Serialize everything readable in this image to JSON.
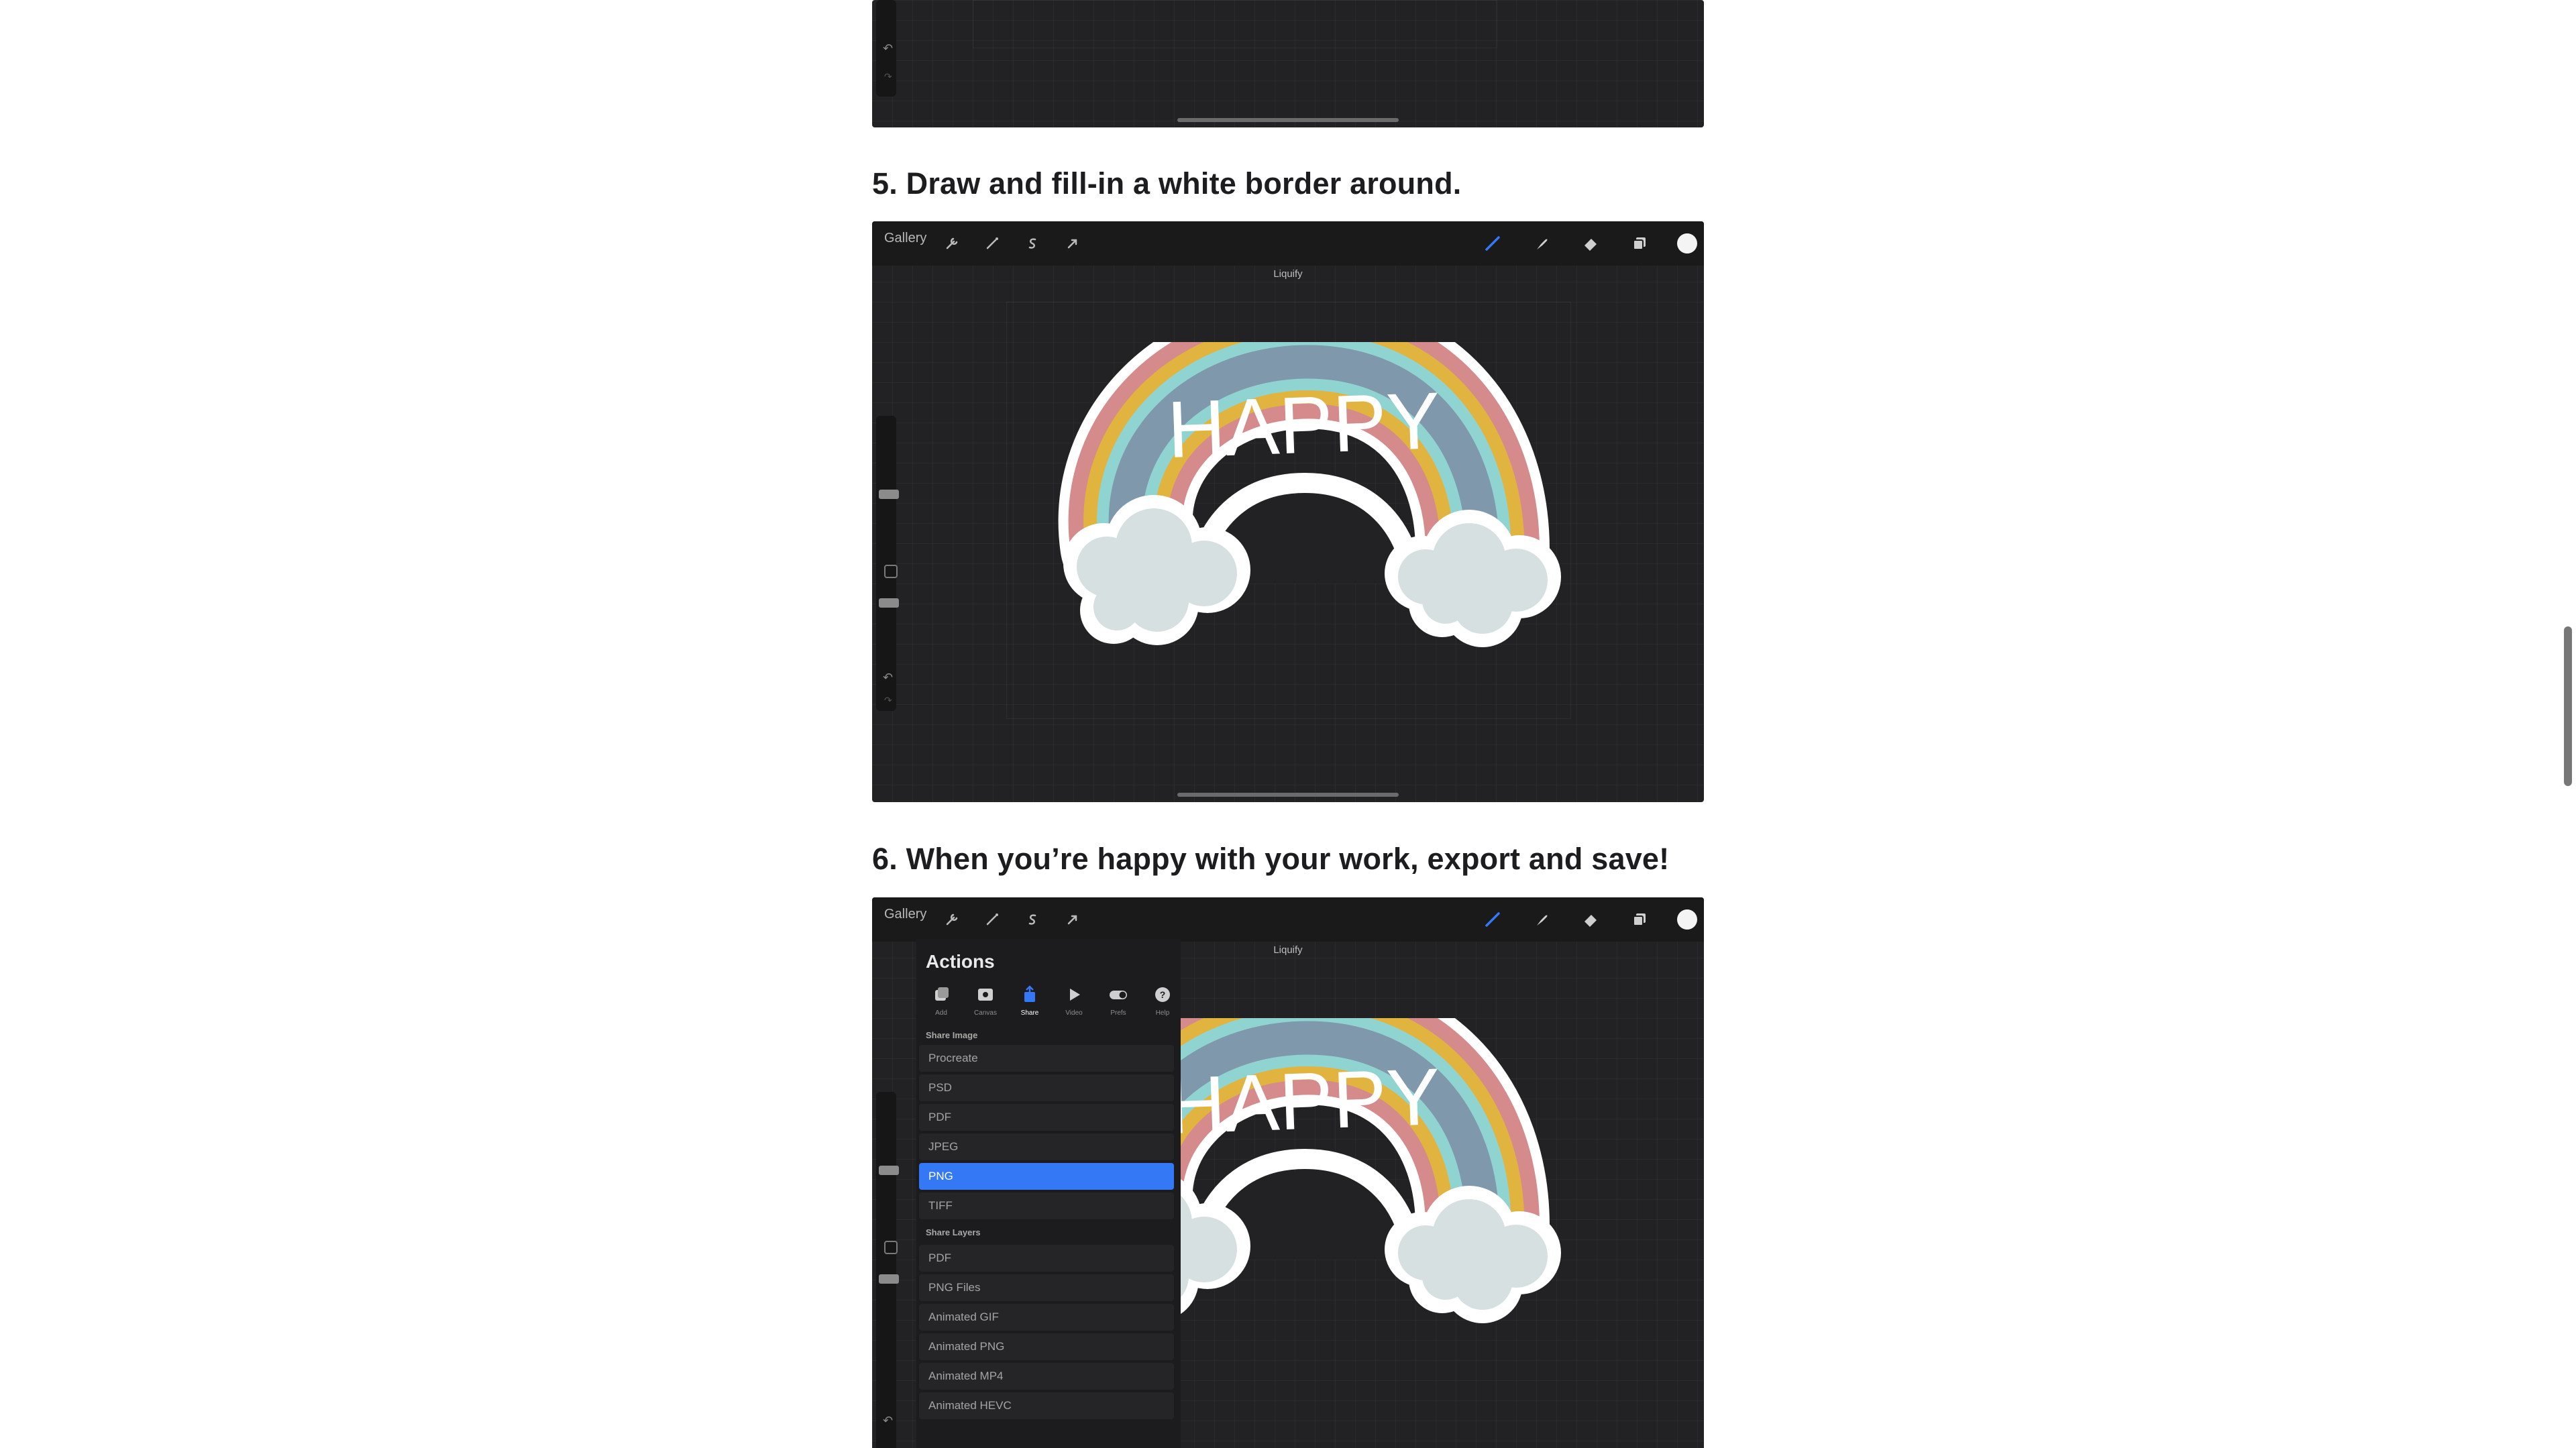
{
  "steps": [
    {
      "heading": "5. Draw and fill-in a white border around."
    },
    {
      "heading": "6. When you’re happy with your work, export and save!"
    }
  ],
  "app": {
    "gallery_label": "Gallery",
    "canvas_label": "Liquify",
    "sticker_text": "HAPPY",
    "toolbar_left_icons": [
      "wrench-icon",
      "magic-wand-icon",
      "selection-s-icon",
      "transform-arrow-icon"
    ],
    "toolbar_right_icons": [
      "brush-icon",
      "smudge-icon",
      "eraser-icon",
      "layers-icon",
      "color-swatch-icon"
    ],
    "accent_color": "#3478f6"
  },
  "actions": {
    "title": "Actions",
    "tabs": [
      {
        "label": "Add",
        "icon": "add-icon"
      },
      {
        "label": "Canvas",
        "icon": "canvas-icon"
      },
      {
        "label": "Share",
        "icon": "share-icon"
      },
      {
        "label": "Video",
        "icon": "video-icon"
      },
      {
        "label": "Prefs",
        "icon": "prefs-toggle-icon"
      },
      {
        "label": "Help",
        "icon": "help-icon"
      }
    ],
    "active_tab": "Share",
    "share_image_label": "Share Image",
    "share_image_items": [
      "Procreate",
      "PSD",
      "PDF",
      "JPEG",
      "PNG",
      "TIFF"
    ],
    "selected_item": "PNG",
    "share_layers_label": "Share Layers",
    "share_layers_items": [
      "PDF",
      "PNG Files",
      "Animated GIF",
      "Animated PNG",
      "Animated MP4",
      "Animated HEVC"
    ]
  }
}
